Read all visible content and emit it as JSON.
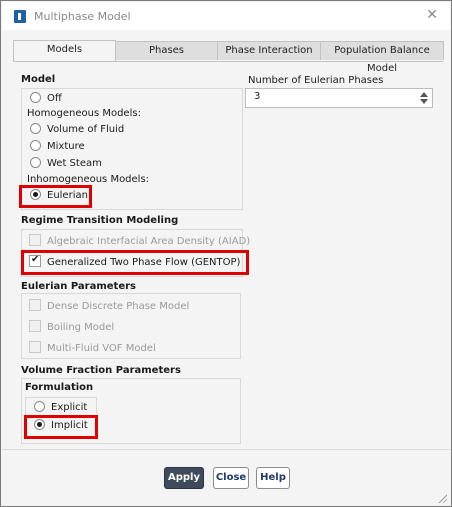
{
  "window": {
    "title": "Multiphase Model",
    "close_icon": "close-icon",
    "app_icon": "fluent-app-icon"
  },
  "tabs": [
    {
      "label": "Models",
      "active": true
    },
    {
      "label": "Phases",
      "active": false
    },
    {
      "label": "Phase Interaction",
      "active": false
    },
    {
      "label": "Population Balance Model",
      "active": false
    }
  ],
  "model": {
    "title": "Model",
    "off": "Off",
    "homogeneous_label": "Homogeneous Models:",
    "volume_of_fluid": "Volume of Fluid",
    "mixture": "Mixture",
    "wet_steam": "Wet Steam",
    "inhomogeneous_label": "Inhomogeneous Models:",
    "eulerian": "Eulerian",
    "selected": "Eulerian"
  },
  "eulerian_phases": {
    "label": "Number of Eulerian Phases",
    "value": "3"
  },
  "regime": {
    "title": "Regime Transition Modeling",
    "aiad": {
      "label": "Algebraic Interfacial Area Density (AIAD)",
      "checked": false,
      "enabled": false
    },
    "gentop": {
      "label": "Generalized Two Phase Flow (GENTOP)",
      "checked": true,
      "enabled": true
    }
  },
  "eulerian_params": {
    "title": "Eulerian Parameters",
    "dense_discrete": {
      "label": "Dense Discrete Phase Model",
      "checked": false,
      "enabled": false
    },
    "boiling": {
      "label": "Boiling Model",
      "checked": false,
      "enabled": false
    },
    "multi_fluid_vof": {
      "label": "Multi-Fluid VOF Model",
      "checked": false,
      "enabled": false
    }
  },
  "volume_fraction": {
    "title": "Volume Fraction Parameters",
    "formulation_title": "Formulation",
    "explicit": "Explicit",
    "implicit": "Implicit",
    "selected": "Implicit"
  },
  "buttons": {
    "apply": "Apply",
    "close": "Close",
    "help": "Help"
  },
  "colors": {
    "highlight": "#e00000",
    "primary_button": "#3f4a5c",
    "app_icon": "#1f5fa8"
  }
}
